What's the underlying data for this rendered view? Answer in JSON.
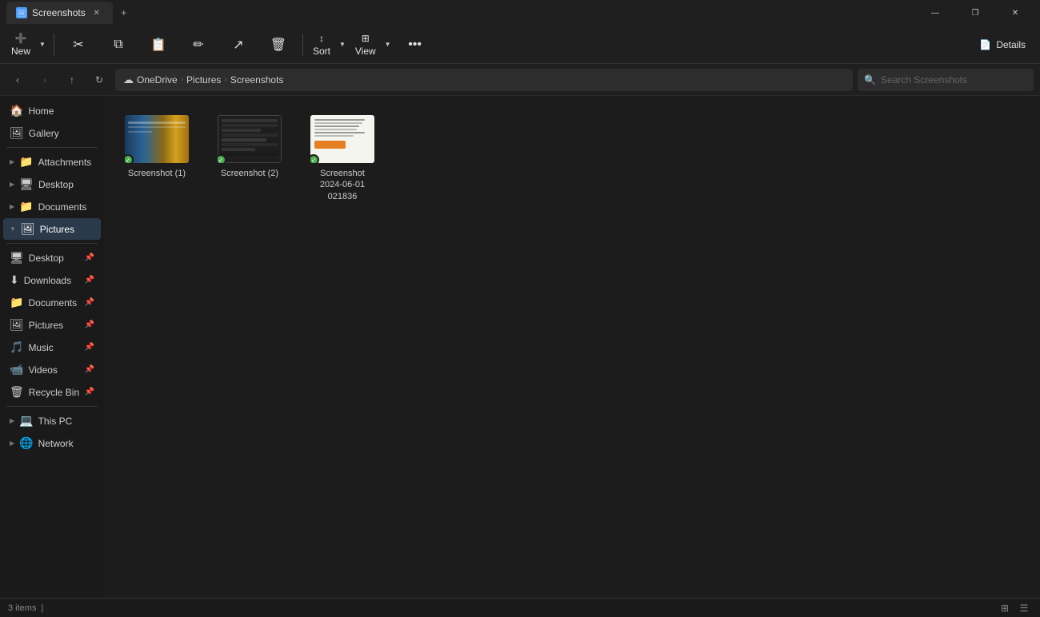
{
  "titleBar": {
    "tab": "Screenshots",
    "tabIcon": "🖼",
    "newTabLabel": "+",
    "minBtn": "—",
    "maxBtn": "❐",
    "closeBtn": "✕"
  },
  "toolbar": {
    "newLabel": "New",
    "cutLabel": "✂",
    "copyLabel": "⧉",
    "pasteLabel": "📋",
    "renameLabel": "✏",
    "deleteLabel": "🗑",
    "sortLabel": "Sort",
    "viewLabel": "View",
    "moreLabel": "•••",
    "detailsLabel": "Details",
    "detailsIcon": "📄"
  },
  "addressBar": {
    "backDisabled": false,
    "forwardDisabled": true,
    "upDisabled": false,
    "refreshLabel": "↻",
    "breadcrumbs": [
      {
        "label": "OneDrive",
        "icon": "☁"
      },
      {
        "label": "Pictures",
        "icon": ""
      },
      {
        "label": "Screenshots",
        "icon": ""
      }
    ],
    "searchPlaceholder": "Search Screenshots"
  },
  "sidebar": {
    "quickAccess": [
      {
        "label": "Home",
        "icon": "🏠",
        "expandable": false
      },
      {
        "label": "Gallery",
        "icon": "🖼",
        "expandable": false
      }
    ],
    "tree": [
      {
        "label": "Attachments",
        "icon": "📁",
        "expandable": true,
        "pinned": false
      },
      {
        "label": "Desktop",
        "icon": "🖥",
        "expandable": true,
        "pinned": false
      },
      {
        "label": "Documents",
        "icon": "📁",
        "expandable": true,
        "pinned": false
      },
      {
        "label": "Pictures",
        "icon": "🖼",
        "expandable": true,
        "active": true,
        "pinned": false
      }
    ],
    "pinned": [
      {
        "label": "Desktop",
        "icon": "🖥",
        "pinned": true
      },
      {
        "label": "Downloads",
        "icon": "⬇",
        "pinned": true
      },
      {
        "label": "Documents",
        "icon": "📁",
        "pinned": true
      },
      {
        "label": "Pictures",
        "icon": "🖼",
        "pinned": true
      },
      {
        "label": "Music",
        "icon": "🎵",
        "pinned": true
      },
      {
        "label": "Videos",
        "icon": "📹",
        "pinned": true
      },
      {
        "label": "Recycle Bin",
        "icon": "🗑",
        "pinned": true
      }
    ],
    "thisPC": {
      "label": "This PC",
      "icon": "💻",
      "expandable": true
    },
    "network": {
      "label": "Network",
      "icon": "🌐",
      "expandable": true
    }
  },
  "content": {
    "files": [
      {
        "name": "Screenshot (1)",
        "type": "screenshot1",
        "synced": true
      },
      {
        "name": "Screenshot (2)",
        "type": "screenshot2",
        "synced": true
      },
      {
        "name": "Screenshot 2024-06-01 021836",
        "type": "doc",
        "synced": true
      }
    ]
  },
  "statusBar": {
    "itemCount": "3 items",
    "separator": "|"
  }
}
